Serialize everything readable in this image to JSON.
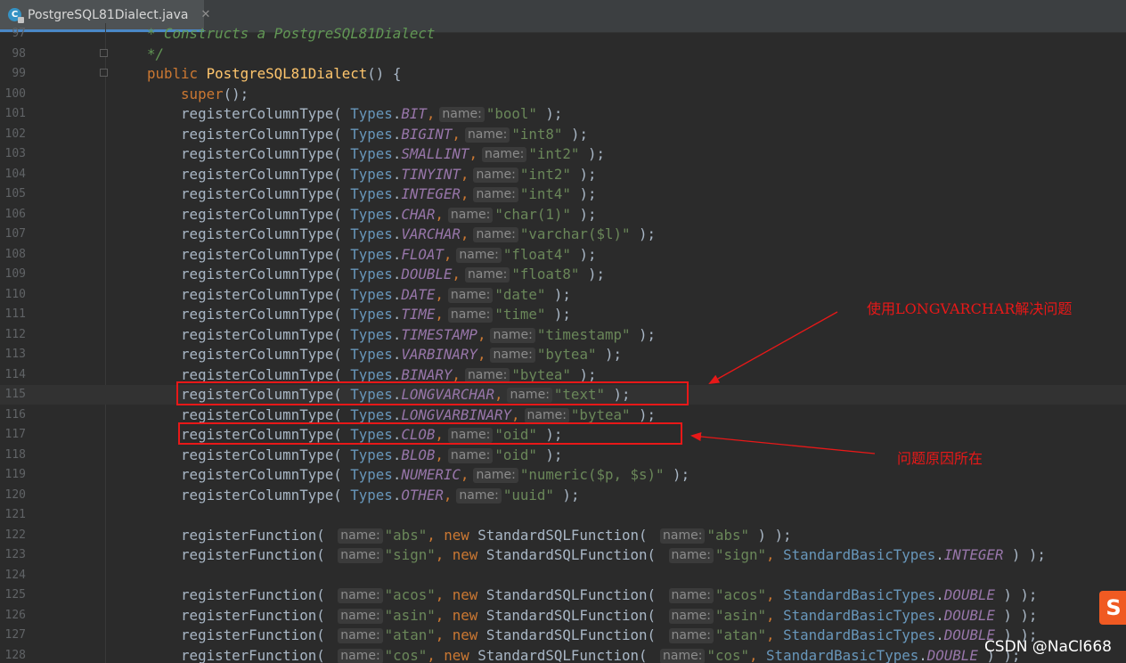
{
  "tab": {
    "title": "PostgreSQL81Dialect.java",
    "close": "✕",
    "icon": "C"
  },
  "lines": [
    {
      "n": "97",
      "t": [
        [
          "cm",
          "* Constructs a PostgreSQL81Dialect"
        ]
      ]
    },
    {
      "n": "98",
      "t": [
        [
          "cm",
          "*/"
        ]
      ]
    },
    {
      "n": "99",
      "t": [
        [
          "kw",
          "public "
        ],
        [
          "fn",
          "PostgreSQL81Dialect"
        ],
        [
          "",
          "() {"
        ]
      ]
    },
    {
      "n": "100",
      "t": [
        [
          "",
          "    "
        ],
        [
          "kw",
          "super"
        ],
        [
          "",
          "();"
        ]
      ]
    },
    {
      "n": "101",
      "t": [
        [
          "",
          "    registerColumnType( "
        ],
        [
          "cls",
          "Types"
        ],
        [
          "",
          "."
        ],
        [
          "const",
          "BIT"
        ],
        [
          "kw",
          ","
        ],
        [
          "hint",
          "name:"
        ],
        [
          "str",
          "\"bool\""
        ],
        [
          "",
          " );"
        ]
      ]
    },
    {
      "n": "102",
      "t": [
        [
          "",
          "    registerColumnType( "
        ],
        [
          "cls",
          "Types"
        ],
        [
          "",
          "."
        ],
        [
          "const",
          "BIGINT"
        ],
        [
          "kw",
          ","
        ],
        [
          "hint",
          "name:"
        ],
        [
          "str",
          "\"int8\""
        ],
        [
          "",
          " );"
        ]
      ]
    },
    {
      "n": "103",
      "t": [
        [
          "",
          "    registerColumnType( "
        ],
        [
          "cls",
          "Types"
        ],
        [
          "",
          "."
        ],
        [
          "const",
          "SMALLINT"
        ],
        [
          "kw",
          ","
        ],
        [
          "hint",
          "name:"
        ],
        [
          "str",
          "\"int2\""
        ],
        [
          "",
          " );"
        ]
      ]
    },
    {
      "n": "104",
      "t": [
        [
          "",
          "    registerColumnType( "
        ],
        [
          "cls",
          "Types"
        ],
        [
          "",
          "."
        ],
        [
          "const",
          "TINYINT"
        ],
        [
          "kw",
          ","
        ],
        [
          "hint",
          "name:"
        ],
        [
          "str",
          "\"int2\""
        ],
        [
          "",
          " );"
        ]
      ]
    },
    {
      "n": "105",
      "t": [
        [
          "",
          "    registerColumnType( "
        ],
        [
          "cls",
          "Types"
        ],
        [
          "",
          "."
        ],
        [
          "const",
          "INTEGER"
        ],
        [
          "kw",
          ","
        ],
        [
          "hint",
          "name:"
        ],
        [
          "str",
          "\"int4\""
        ],
        [
          "",
          " );"
        ]
      ]
    },
    {
      "n": "106",
      "t": [
        [
          "",
          "    registerColumnType( "
        ],
        [
          "cls",
          "Types"
        ],
        [
          "",
          "."
        ],
        [
          "const",
          "CHAR"
        ],
        [
          "kw",
          ","
        ],
        [
          "hint",
          "name:"
        ],
        [
          "str",
          "\"char(1)\""
        ],
        [
          "",
          " );"
        ]
      ]
    },
    {
      "n": "107",
      "t": [
        [
          "",
          "    registerColumnType( "
        ],
        [
          "cls",
          "Types"
        ],
        [
          "",
          "."
        ],
        [
          "const",
          "VARCHAR"
        ],
        [
          "kw",
          ","
        ],
        [
          "hint",
          "name:"
        ],
        [
          "str",
          "\"varchar($l)\""
        ],
        [
          "",
          " );"
        ]
      ]
    },
    {
      "n": "108",
      "t": [
        [
          "",
          "    registerColumnType( "
        ],
        [
          "cls",
          "Types"
        ],
        [
          "",
          "."
        ],
        [
          "const",
          "FLOAT"
        ],
        [
          "kw",
          ","
        ],
        [
          "hint",
          "name:"
        ],
        [
          "str",
          "\"float4\""
        ],
        [
          "",
          " );"
        ]
      ]
    },
    {
      "n": "109",
      "t": [
        [
          "",
          "    registerColumnType( "
        ],
        [
          "cls",
          "Types"
        ],
        [
          "",
          "."
        ],
        [
          "const",
          "DOUBLE"
        ],
        [
          "kw",
          ","
        ],
        [
          "hint",
          "name:"
        ],
        [
          "str",
          "\"float8\""
        ],
        [
          "",
          " );"
        ]
      ]
    },
    {
      "n": "110",
      "t": [
        [
          "",
          "    registerColumnType( "
        ],
        [
          "cls",
          "Types"
        ],
        [
          "",
          "."
        ],
        [
          "const",
          "DATE"
        ],
        [
          "kw",
          ","
        ],
        [
          "hint",
          "name:"
        ],
        [
          "str",
          "\"date\""
        ],
        [
          "",
          " );"
        ]
      ]
    },
    {
      "n": "111",
      "t": [
        [
          "",
          "    registerColumnType( "
        ],
        [
          "cls",
          "Types"
        ],
        [
          "",
          "."
        ],
        [
          "const",
          "TIME"
        ],
        [
          "kw",
          ","
        ],
        [
          "hint",
          "name:"
        ],
        [
          "str",
          "\"time\""
        ],
        [
          "",
          " );"
        ]
      ]
    },
    {
      "n": "112",
      "t": [
        [
          "",
          "    registerColumnType( "
        ],
        [
          "cls",
          "Types"
        ],
        [
          "",
          "."
        ],
        [
          "const",
          "TIMESTAMP"
        ],
        [
          "kw",
          ","
        ],
        [
          "hint",
          "name:"
        ],
        [
          "str",
          "\"timestamp\""
        ],
        [
          "",
          " );"
        ]
      ]
    },
    {
      "n": "113",
      "t": [
        [
          "",
          "    registerColumnType( "
        ],
        [
          "cls",
          "Types"
        ],
        [
          "",
          "."
        ],
        [
          "const",
          "VARBINARY"
        ],
        [
          "kw",
          ","
        ],
        [
          "hint",
          "name:"
        ],
        [
          "str",
          "\"bytea\""
        ],
        [
          "",
          " );"
        ]
      ]
    },
    {
      "n": "114",
      "t": [
        [
          "",
          "    registerColumnType( "
        ],
        [
          "cls",
          "Types"
        ],
        [
          "",
          "."
        ],
        [
          "const",
          "BINARY"
        ],
        [
          "kw",
          ","
        ],
        [
          "hint",
          "name:"
        ],
        [
          "str",
          "\"bytea\""
        ],
        [
          "",
          " );"
        ]
      ]
    },
    {
      "n": "115",
      "t": [
        [
          "",
          "    registerColumnType( "
        ],
        [
          "cls",
          "Types"
        ],
        [
          "",
          "."
        ],
        [
          "const",
          "LONGVARCHAR"
        ],
        [
          "kw",
          ","
        ],
        [
          "hint",
          "name:"
        ],
        [
          "str",
          "\"text\""
        ],
        [
          "",
          " );"
        ]
      ]
    },
    {
      "n": "116",
      "t": [
        [
          "",
          "    registerColumnType( "
        ],
        [
          "cls",
          "Types"
        ],
        [
          "",
          "."
        ],
        [
          "const",
          "LONGVARBINARY"
        ],
        [
          "kw",
          ","
        ],
        [
          "hint",
          "name:"
        ],
        [
          "str",
          "\"bytea\""
        ],
        [
          "",
          " );"
        ]
      ]
    },
    {
      "n": "117",
      "t": [
        [
          "",
          "    registerColumnType( "
        ],
        [
          "cls",
          "Types"
        ],
        [
          "",
          "."
        ],
        [
          "const",
          "CLOB"
        ],
        [
          "kw",
          ","
        ],
        [
          "hint",
          "name:"
        ],
        [
          "str",
          "\"oid\""
        ],
        [
          "",
          " );"
        ]
      ]
    },
    {
      "n": "118",
      "t": [
        [
          "",
          "    registerColumnType( "
        ],
        [
          "cls",
          "Types"
        ],
        [
          "",
          "."
        ],
        [
          "const",
          "BLOB"
        ],
        [
          "kw",
          ","
        ],
        [
          "hint",
          "name:"
        ],
        [
          "str",
          "\"oid\""
        ],
        [
          "",
          " );"
        ]
      ]
    },
    {
      "n": "119",
      "t": [
        [
          "",
          "    registerColumnType( "
        ],
        [
          "cls",
          "Types"
        ],
        [
          "",
          "."
        ],
        [
          "const",
          "NUMERIC"
        ],
        [
          "kw",
          ","
        ],
        [
          "hint",
          "name:"
        ],
        [
          "str",
          "\"numeric($p, $s)\""
        ],
        [
          "",
          " );"
        ]
      ]
    },
    {
      "n": "120",
      "t": [
        [
          "",
          "    registerColumnType( "
        ],
        [
          "cls",
          "Types"
        ],
        [
          "",
          "."
        ],
        [
          "const",
          "OTHER"
        ],
        [
          "kw",
          ","
        ],
        [
          "hint",
          "name:"
        ],
        [
          "str",
          "\"uuid\""
        ],
        [
          "",
          " );"
        ]
      ]
    },
    {
      "n": "121",
      "t": []
    },
    {
      "n": "122",
      "t": [
        [
          "",
          "    registerFunction( "
        ],
        [
          "hint",
          "name:"
        ],
        [
          "str",
          "\"abs\""
        ],
        [
          "kw",
          ", new "
        ],
        [
          "",
          "StandardSQLFunction( "
        ],
        [
          "hint",
          "name:"
        ],
        [
          "str",
          "\"abs\""
        ],
        [
          "",
          " ) );"
        ]
      ]
    },
    {
      "n": "123",
      "t": [
        [
          "",
          "    registerFunction( "
        ],
        [
          "hint",
          "name:"
        ],
        [
          "str",
          "\"sign\""
        ],
        [
          "kw",
          ", new "
        ],
        [
          "",
          "StandardSQLFunction( "
        ],
        [
          "hint",
          "name:"
        ],
        [
          "str",
          "\"sign\""
        ],
        [
          "kw",
          ", "
        ],
        [
          "cls",
          "StandardBasicTypes"
        ],
        [
          "",
          "."
        ],
        [
          "const",
          "INTEGER"
        ],
        [
          "",
          " ) );"
        ]
      ]
    },
    {
      "n": "124",
      "t": []
    },
    {
      "n": "125",
      "t": [
        [
          "",
          "    registerFunction( "
        ],
        [
          "hint",
          "name:"
        ],
        [
          "str",
          "\"acos\""
        ],
        [
          "kw",
          ", new "
        ],
        [
          "",
          "StandardSQLFunction( "
        ],
        [
          "hint",
          "name:"
        ],
        [
          "str",
          "\"acos\""
        ],
        [
          "kw",
          ", "
        ],
        [
          "cls",
          "StandardBasicTypes"
        ],
        [
          "",
          "."
        ],
        [
          "const",
          "DOUBLE"
        ],
        [
          "",
          " ) );"
        ]
      ]
    },
    {
      "n": "126",
      "t": [
        [
          "",
          "    registerFunction( "
        ],
        [
          "hint",
          "name:"
        ],
        [
          "str",
          "\"asin\""
        ],
        [
          "kw",
          ", new "
        ],
        [
          "",
          "StandardSQLFunction( "
        ],
        [
          "hint",
          "name:"
        ],
        [
          "str",
          "\"asin\""
        ],
        [
          "kw",
          ", "
        ],
        [
          "cls",
          "StandardBasicTypes"
        ],
        [
          "",
          "."
        ],
        [
          "const",
          "DOUBLE"
        ],
        [
          "",
          " ) );"
        ]
      ]
    },
    {
      "n": "127",
      "t": [
        [
          "",
          "    registerFunction( "
        ],
        [
          "hint",
          "name:"
        ],
        [
          "str",
          "\"atan\""
        ],
        [
          "kw",
          ", new "
        ],
        [
          "",
          "StandardSQLFunction( "
        ],
        [
          "hint",
          "name:"
        ],
        [
          "str",
          "\"atan\""
        ],
        [
          "kw",
          ", "
        ],
        [
          "cls",
          "StandardBasicTypes"
        ],
        [
          "",
          "."
        ],
        [
          "const",
          "DOUBLE"
        ],
        [
          "",
          " ) );"
        ]
      ]
    },
    {
      "n": "128",
      "t": [
        [
          "",
          "    registerFunction( "
        ],
        [
          "hint",
          "name:"
        ],
        [
          "str",
          "\"cos\""
        ],
        [
          "kw",
          ", new "
        ],
        [
          "",
          "StandardSQLFunction( "
        ],
        [
          "hint",
          "name:"
        ],
        [
          "str",
          "\"cos\""
        ],
        [
          "kw",
          ", "
        ],
        [
          "cls",
          "StandardBasicTypes"
        ],
        [
          "",
          "."
        ],
        [
          "const",
          "DOUBLE"
        ],
        [
          "",
          " ) );"
        ]
      ]
    }
  ],
  "annotations": {
    "fix": "使用LONGVARCHAR解决问题",
    "cause": "问题原因所在"
  },
  "watermark": "CSDN @NaCl668",
  "sogou_logo": "S",
  "colors": {
    "background": "#2b2b2b",
    "keyword": "#cc7832",
    "string": "#6a8759",
    "constant": "#9876aa",
    "class": "#6897bb",
    "method": "#ffc66d",
    "annotation_red": "#e81818"
  }
}
